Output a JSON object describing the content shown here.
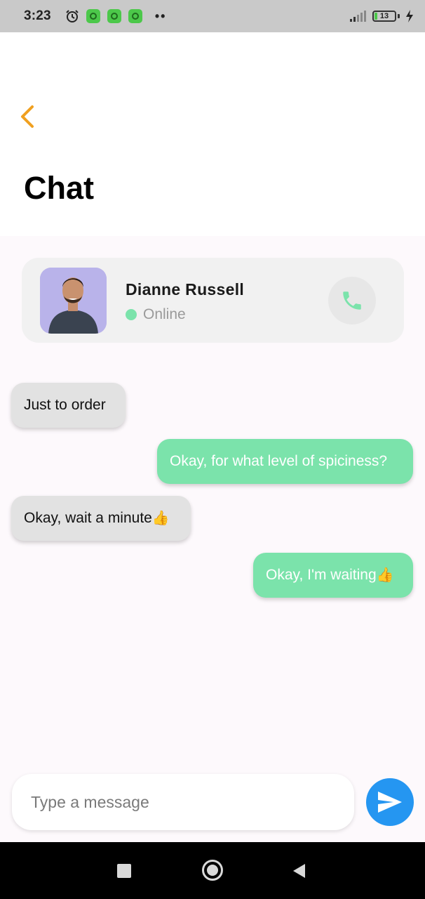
{
  "status_bar": {
    "time": "3:23",
    "battery_level": "13",
    "icons": [
      "alarm-icon",
      "app-notification-icon",
      "app-notification-icon",
      "app-notification-icon",
      "more-dots-icon",
      "signal-icon",
      "battery-icon",
      "charging-icon"
    ]
  },
  "header": {
    "back_icon": "chevron-left-icon",
    "title": "Chat"
  },
  "contact": {
    "name": "Dianne Russell",
    "status": "Online",
    "status_color": "#7be3ab",
    "call_icon": "phone-icon"
  },
  "messages": [
    {
      "direction": "incoming",
      "text": "Just to order",
      "emoji": ""
    },
    {
      "direction": "outgoing",
      "text": "Okay, for what level of spiciness?",
      "emoji": ""
    },
    {
      "direction": "incoming",
      "text": "Okay, wait a minute",
      "emoji": "👍"
    },
    {
      "direction": "outgoing",
      "text": "Okay, I'm waiting",
      "emoji": "👍"
    }
  ],
  "composer": {
    "placeholder": "Type a message",
    "value": "",
    "send_icon": "send-icon"
  },
  "colors": {
    "accent_back": "#f0a020",
    "outgoing_bubble": "#7be3ab",
    "incoming_bubble": "#e2e2e2",
    "send_button": "#2596f1"
  },
  "nav_bar": {
    "icons": [
      "recents-icon",
      "home-icon",
      "back-icon"
    ]
  }
}
